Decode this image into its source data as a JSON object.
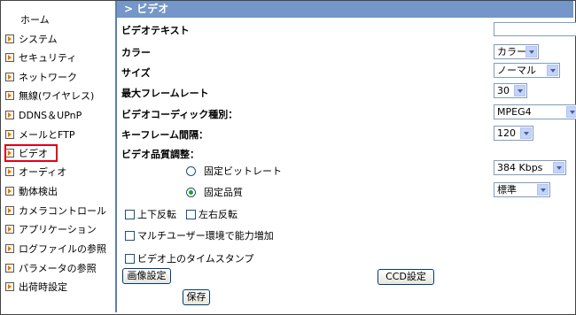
{
  "sidebar": {
    "items": [
      {
        "label": "ホーム"
      },
      {
        "label": "システム"
      },
      {
        "label": "セキュリティ"
      },
      {
        "label": "ネットワーク"
      },
      {
        "label": "無線(ワイヤレス)"
      },
      {
        "label": "DDNS＆UPnP"
      },
      {
        "label": "メールとFTP"
      },
      {
        "label": "ビデオ"
      },
      {
        "label": "オーディオ"
      },
      {
        "label": "動体検出"
      },
      {
        "label": "カメラコントロール"
      },
      {
        "label": "アプリケーション"
      },
      {
        "label": "ログファイルの参照"
      },
      {
        "label": "パラメータの参照"
      },
      {
        "label": "出荷時設定"
      }
    ],
    "selected": "ビデオ"
  },
  "header": {
    "title": "> ビデオ"
  },
  "form": {
    "video_text_label": "ビデオテキスト",
    "video_text_value": "",
    "color_label": "カラー",
    "color_value": "カラー",
    "size_label": "サイズ",
    "size_value": "ノーマル",
    "max_frame_rate_label": "最大フレームレート",
    "max_frame_rate_value": "30",
    "codec_label": "ビデオコーディック種別：",
    "codec_value": "MPEG4",
    "keyframe_label": "キーフレーム間隔：",
    "keyframe_value": "120",
    "quality_label": "ビデオ品質調整：",
    "fixed_bitrate_label": "固定ビットレート",
    "fixed_bitrate_value": "384 Kbps",
    "fixed_quality_label": "固定品質",
    "fixed_quality_value": "標準",
    "flip_label": "上下反転",
    "mirror_label": "左右反転",
    "multi_user_label": "マルチユーザー環境で能力増加",
    "timestamp_label": "ビデオ上のタイムスタンプ",
    "image_settings_button": "画像設定",
    "ccd_settings_button": "CCD設定",
    "save_button": "保存"
  },
  "colors": {
    "header_bg": "#7496c8",
    "arrow": "#e07800",
    "selection": "#e0001a"
  }
}
